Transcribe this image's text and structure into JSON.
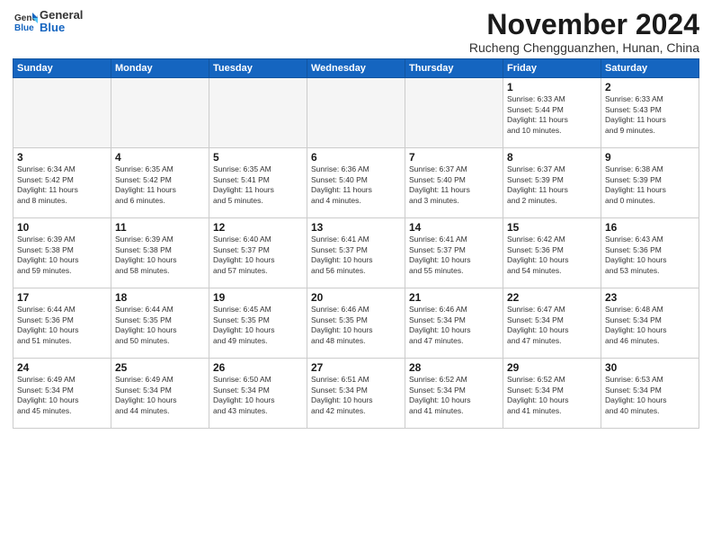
{
  "header": {
    "logo_line1": "General",
    "logo_line2": "Blue",
    "month_title": "November 2024",
    "location": "Rucheng Chengguanzhen, Hunan, China"
  },
  "calendar": {
    "days_of_week": [
      "Sunday",
      "Monday",
      "Tuesday",
      "Wednesday",
      "Thursday",
      "Friday",
      "Saturday"
    ],
    "weeks": [
      [
        {
          "day": "",
          "empty": true
        },
        {
          "day": "",
          "empty": true
        },
        {
          "day": "",
          "empty": true
        },
        {
          "day": "",
          "empty": true
        },
        {
          "day": "",
          "empty": true
        },
        {
          "day": "1",
          "info": "Sunrise: 6:33 AM\nSunset: 5:44 PM\nDaylight: 11 hours\nand 10 minutes."
        },
        {
          "day": "2",
          "info": "Sunrise: 6:33 AM\nSunset: 5:43 PM\nDaylight: 11 hours\nand 9 minutes."
        }
      ],
      [
        {
          "day": "3",
          "info": "Sunrise: 6:34 AM\nSunset: 5:42 PM\nDaylight: 11 hours\nand 8 minutes."
        },
        {
          "day": "4",
          "info": "Sunrise: 6:35 AM\nSunset: 5:42 PM\nDaylight: 11 hours\nand 6 minutes."
        },
        {
          "day": "5",
          "info": "Sunrise: 6:35 AM\nSunset: 5:41 PM\nDaylight: 11 hours\nand 5 minutes."
        },
        {
          "day": "6",
          "info": "Sunrise: 6:36 AM\nSunset: 5:40 PM\nDaylight: 11 hours\nand 4 minutes."
        },
        {
          "day": "7",
          "info": "Sunrise: 6:37 AM\nSunset: 5:40 PM\nDaylight: 11 hours\nand 3 minutes."
        },
        {
          "day": "8",
          "info": "Sunrise: 6:37 AM\nSunset: 5:39 PM\nDaylight: 11 hours\nand 2 minutes."
        },
        {
          "day": "9",
          "info": "Sunrise: 6:38 AM\nSunset: 5:39 PM\nDaylight: 11 hours\nand 0 minutes."
        }
      ],
      [
        {
          "day": "10",
          "info": "Sunrise: 6:39 AM\nSunset: 5:38 PM\nDaylight: 10 hours\nand 59 minutes."
        },
        {
          "day": "11",
          "info": "Sunrise: 6:39 AM\nSunset: 5:38 PM\nDaylight: 10 hours\nand 58 minutes."
        },
        {
          "day": "12",
          "info": "Sunrise: 6:40 AM\nSunset: 5:37 PM\nDaylight: 10 hours\nand 57 minutes."
        },
        {
          "day": "13",
          "info": "Sunrise: 6:41 AM\nSunset: 5:37 PM\nDaylight: 10 hours\nand 56 minutes."
        },
        {
          "day": "14",
          "info": "Sunrise: 6:41 AM\nSunset: 5:37 PM\nDaylight: 10 hours\nand 55 minutes."
        },
        {
          "day": "15",
          "info": "Sunrise: 6:42 AM\nSunset: 5:36 PM\nDaylight: 10 hours\nand 54 minutes."
        },
        {
          "day": "16",
          "info": "Sunrise: 6:43 AM\nSunset: 5:36 PM\nDaylight: 10 hours\nand 53 minutes."
        }
      ],
      [
        {
          "day": "17",
          "info": "Sunrise: 6:44 AM\nSunset: 5:36 PM\nDaylight: 10 hours\nand 51 minutes."
        },
        {
          "day": "18",
          "info": "Sunrise: 6:44 AM\nSunset: 5:35 PM\nDaylight: 10 hours\nand 50 minutes."
        },
        {
          "day": "19",
          "info": "Sunrise: 6:45 AM\nSunset: 5:35 PM\nDaylight: 10 hours\nand 49 minutes."
        },
        {
          "day": "20",
          "info": "Sunrise: 6:46 AM\nSunset: 5:35 PM\nDaylight: 10 hours\nand 48 minutes."
        },
        {
          "day": "21",
          "info": "Sunrise: 6:46 AM\nSunset: 5:34 PM\nDaylight: 10 hours\nand 47 minutes."
        },
        {
          "day": "22",
          "info": "Sunrise: 6:47 AM\nSunset: 5:34 PM\nDaylight: 10 hours\nand 47 minutes."
        },
        {
          "day": "23",
          "info": "Sunrise: 6:48 AM\nSunset: 5:34 PM\nDaylight: 10 hours\nand 46 minutes."
        }
      ],
      [
        {
          "day": "24",
          "info": "Sunrise: 6:49 AM\nSunset: 5:34 PM\nDaylight: 10 hours\nand 45 minutes."
        },
        {
          "day": "25",
          "info": "Sunrise: 6:49 AM\nSunset: 5:34 PM\nDaylight: 10 hours\nand 44 minutes."
        },
        {
          "day": "26",
          "info": "Sunrise: 6:50 AM\nSunset: 5:34 PM\nDaylight: 10 hours\nand 43 minutes."
        },
        {
          "day": "27",
          "info": "Sunrise: 6:51 AM\nSunset: 5:34 PM\nDaylight: 10 hours\nand 42 minutes."
        },
        {
          "day": "28",
          "info": "Sunrise: 6:52 AM\nSunset: 5:34 PM\nDaylight: 10 hours\nand 41 minutes."
        },
        {
          "day": "29",
          "info": "Sunrise: 6:52 AM\nSunset: 5:34 PM\nDaylight: 10 hours\nand 41 minutes."
        },
        {
          "day": "30",
          "info": "Sunrise: 6:53 AM\nSunset: 5:34 PM\nDaylight: 10 hours\nand 40 minutes."
        }
      ]
    ]
  }
}
